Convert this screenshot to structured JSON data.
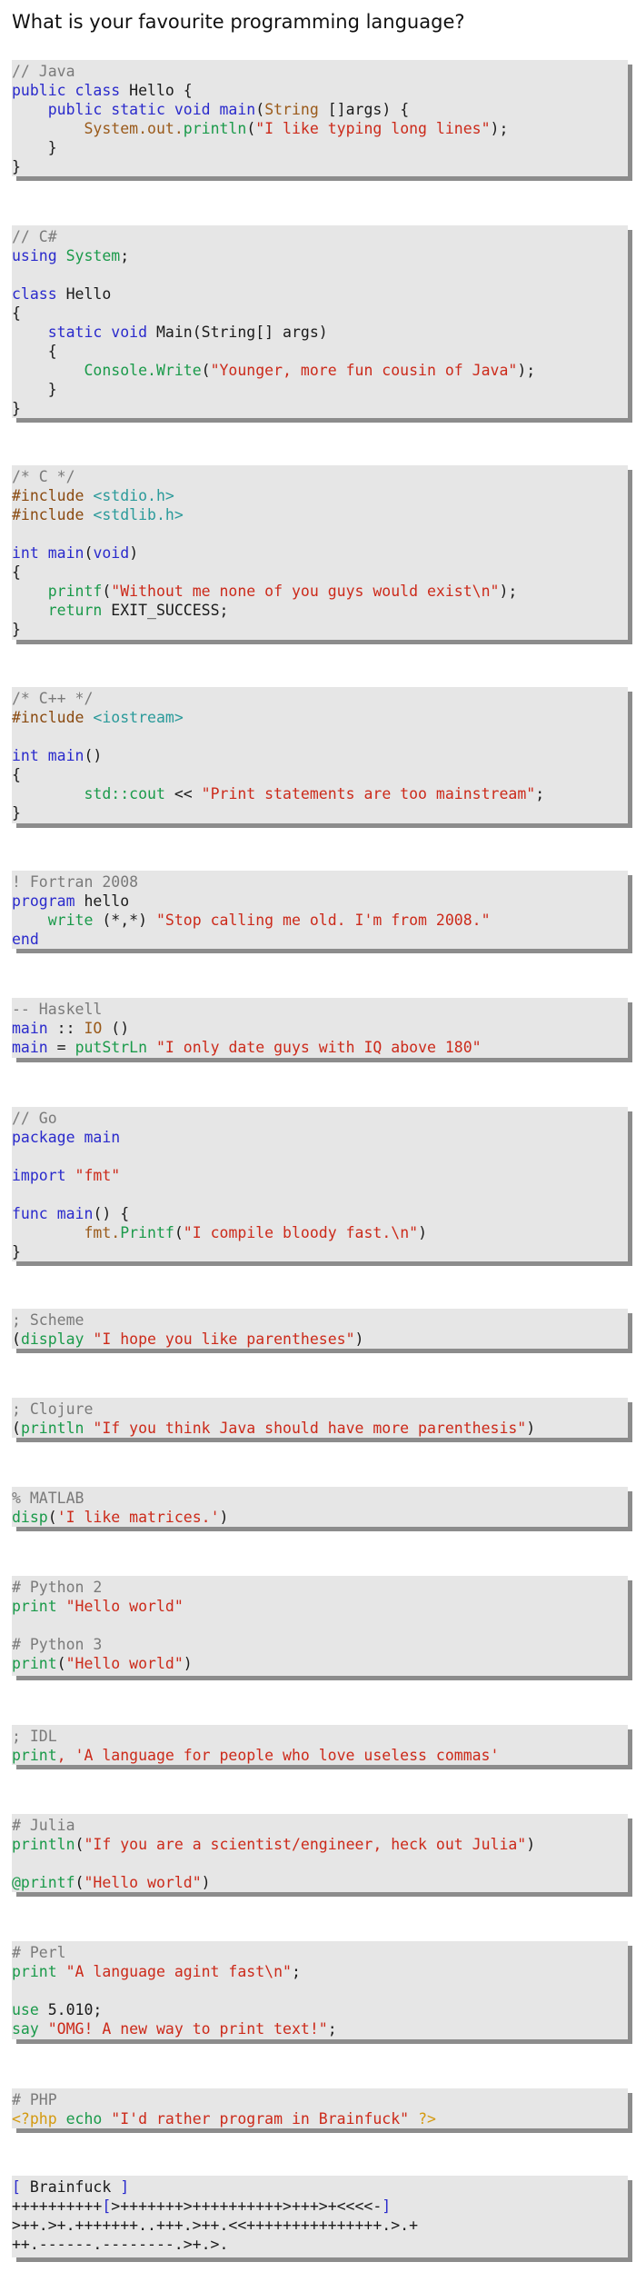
{
  "page": {
    "title": "What is your favourite programming language?"
  },
  "colors": {
    "comment": "#7a7a7a",
    "keyword": "#2a2acc",
    "string": "#cc2a1a",
    "function": "#1a9a4a",
    "type": "#9a5a1a",
    "preprocessor": "#8a4a10",
    "include_file": "#2a9a9a",
    "php_tag": "#d49a10",
    "block_background": "#e6e6e6",
    "block_shadow": "#8c8c8c"
  },
  "snippets": [
    {
      "language": "java",
      "lines": [
        [
          [
            "com",
            "// Java"
          ]
        ],
        [
          [
            "kw",
            "public class"
          ],
          [
            "pl",
            " Hello {"
          ]
        ],
        [
          [
            "pl",
            "    "
          ],
          [
            "kw",
            "public static void"
          ],
          [
            "pl",
            " "
          ],
          [
            "kw",
            "main"
          ],
          [
            "pl",
            "("
          ],
          [
            "typ",
            "String"
          ],
          [
            "pl",
            " []args) {"
          ]
        ],
        [
          [
            "pl",
            "        "
          ],
          [
            "typ",
            "System.out."
          ],
          [
            "fn",
            "println"
          ],
          [
            "pl",
            "("
          ],
          [
            "str",
            "\"I like typing long lines\""
          ],
          [
            "pl",
            ");"
          ]
        ],
        [
          [
            "pl",
            "    }"
          ]
        ],
        [
          [
            "pl",
            "}"
          ]
        ]
      ]
    },
    {
      "language": "csharp",
      "lines": [
        [
          [
            "com",
            "// C#"
          ]
        ],
        [
          [
            "kw",
            "using"
          ],
          [
            "pl",
            " "
          ],
          [
            "fn",
            "System"
          ],
          [
            "pl",
            ";"
          ]
        ],
        [
          [
            "pl",
            ""
          ]
        ],
        [
          [
            "kw",
            "class"
          ],
          [
            "pl",
            " Hello"
          ]
        ],
        [
          [
            "pl",
            "{"
          ]
        ],
        [
          [
            "pl",
            "    "
          ],
          [
            "kw",
            "static void"
          ],
          [
            "pl",
            " Main(String[] args)"
          ]
        ],
        [
          [
            "pl",
            "    {"
          ]
        ],
        [
          [
            "pl",
            "        "
          ],
          [
            "fn",
            "Console.Write"
          ],
          [
            "pl",
            "("
          ],
          [
            "str",
            "\"Younger, more fun cousin of Java\""
          ],
          [
            "pl",
            ");"
          ]
        ],
        [
          [
            "pl",
            "    }"
          ]
        ],
        [
          [
            "pl",
            "}"
          ]
        ]
      ]
    },
    {
      "language": "c",
      "lines": [
        [
          [
            "com",
            "/* C */"
          ]
        ],
        [
          [
            "pre",
            "#include"
          ],
          [
            "pl",
            " "
          ],
          [
            "inc",
            "<stdio.h>"
          ]
        ],
        [
          [
            "pre",
            "#include"
          ],
          [
            "pl",
            " "
          ],
          [
            "inc",
            "<stdlib.h>"
          ]
        ],
        [
          [
            "pl",
            ""
          ]
        ],
        [
          [
            "kw",
            "int"
          ],
          [
            "pl",
            " "
          ],
          [
            "kw",
            "main"
          ],
          [
            "pl",
            "("
          ],
          [
            "kw",
            "void"
          ],
          [
            "pl",
            ")"
          ]
        ],
        [
          [
            "pl",
            "{"
          ]
        ],
        [
          [
            "pl",
            "    "
          ],
          [
            "fn",
            "printf"
          ],
          [
            "pl",
            "("
          ],
          [
            "str",
            "\"Without me none of you guys would exist\\n\""
          ],
          [
            "pl",
            ");"
          ]
        ],
        [
          [
            "pl",
            "    "
          ],
          [
            "fn",
            "return"
          ],
          [
            "pl",
            " EXIT_SUCCESS;"
          ]
        ],
        [
          [
            "pl",
            "}"
          ]
        ]
      ]
    },
    {
      "language": "cpp",
      "lines": [
        [
          [
            "com",
            "/* C++ */"
          ]
        ],
        [
          [
            "pre",
            "#include"
          ],
          [
            "pl",
            " "
          ],
          [
            "inc",
            "<iostream>"
          ]
        ],
        [
          [
            "pl",
            ""
          ]
        ],
        [
          [
            "kw",
            "int"
          ],
          [
            "pl",
            " "
          ],
          [
            "kw",
            "main"
          ],
          [
            "pl",
            "()"
          ]
        ],
        [
          [
            "pl",
            "{"
          ]
        ],
        [
          [
            "pl",
            "        "
          ],
          [
            "fn",
            "std::cout"
          ],
          [
            "pl",
            " << "
          ],
          [
            "str",
            "\"Print statements are too mainstream\""
          ],
          [
            "pl",
            ";"
          ]
        ],
        [
          [
            "pl",
            "}"
          ]
        ]
      ]
    },
    {
      "language": "fortran",
      "lines": [
        [
          [
            "com",
            "! Fortran 2008"
          ]
        ],
        [
          [
            "kw",
            "program"
          ],
          [
            "pl",
            " hello"
          ]
        ],
        [
          [
            "pl",
            "    "
          ],
          [
            "fn",
            "write"
          ],
          [
            "pl",
            " (*,*) "
          ],
          [
            "str",
            "\"Stop calling me old. I'm from 2008.\""
          ]
        ],
        [
          [
            "kw",
            "end"
          ]
        ]
      ]
    },
    {
      "language": "haskell",
      "lines": [
        [
          [
            "com",
            "-- Haskell"
          ]
        ],
        [
          [
            "kw",
            "main"
          ],
          [
            "pl",
            " :: "
          ],
          [
            "typ",
            "IO"
          ],
          [
            "pl",
            " ()"
          ]
        ],
        [
          [
            "kw",
            "main"
          ],
          [
            "pl",
            " = "
          ],
          [
            "fn",
            "putStrLn"
          ],
          [
            "pl",
            " "
          ],
          [
            "str",
            "\"I only date guys with IQ above 180\""
          ]
        ]
      ]
    },
    {
      "language": "go",
      "lines": [
        [
          [
            "com",
            "// Go"
          ]
        ],
        [
          [
            "kw",
            "package main"
          ]
        ],
        [
          [
            "pl",
            ""
          ]
        ],
        [
          [
            "kw",
            "import"
          ],
          [
            "pl",
            " "
          ],
          [
            "str",
            "\"fmt\""
          ]
        ],
        [
          [
            "pl",
            ""
          ]
        ],
        [
          [
            "kw",
            "func"
          ],
          [
            "pl",
            " "
          ],
          [
            "kw",
            "main"
          ],
          [
            "pl",
            "() {"
          ]
        ],
        [
          [
            "pl",
            "        "
          ],
          [
            "typ",
            "fmt."
          ],
          [
            "fn",
            "Printf"
          ],
          [
            "pl",
            "("
          ],
          [
            "str",
            "\"I compile bloody fast.\\n\""
          ],
          [
            "pl",
            ")"
          ]
        ],
        [
          [
            "pl",
            "}"
          ]
        ]
      ]
    },
    {
      "language": "scheme",
      "lines": [
        [
          [
            "com",
            "; Scheme"
          ]
        ],
        [
          [
            "pl",
            "("
          ],
          [
            "fn",
            "display"
          ],
          [
            "pl",
            " "
          ],
          [
            "str",
            "\"I hope you like parentheses\""
          ],
          [
            "pl",
            ")"
          ]
        ]
      ]
    },
    {
      "language": "clojure",
      "lines": [
        [
          [
            "com",
            "; Clojure"
          ]
        ],
        [
          [
            "pl",
            "("
          ],
          [
            "fn",
            "println"
          ],
          [
            "pl",
            " "
          ],
          [
            "str",
            "\"If you think Java should have more parenthesis\""
          ],
          [
            "pl",
            ")"
          ]
        ]
      ]
    },
    {
      "language": "matlab",
      "lines": [
        [
          [
            "com",
            "% MATLAB"
          ]
        ],
        [
          [
            "fn",
            "disp"
          ],
          [
            "pl",
            "("
          ],
          [
            "str",
            "'I like matrices.'"
          ],
          [
            "pl",
            ")"
          ]
        ]
      ]
    },
    {
      "language": "python",
      "lines": [
        [
          [
            "com",
            "# Python 2"
          ]
        ],
        [
          [
            "fn",
            "print"
          ],
          [
            "pl",
            " "
          ],
          [
            "str",
            "\"Hello world\""
          ]
        ],
        [
          [
            "pl",
            ""
          ]
        ],
        [
          [
            "com",
            "# Python 3"
          ]
        ],
        [
          [
            "fn",
            "print"
          ],
          [
            "pl",
            "("
          ],
          [
            "str",
            "\"Hello world\""
          ],
          [
            "pl",
            ")"
          ]
        ]
      ]
    },
    {
      "language": "idl",
      "lines": [
        [
          [
            "com",
            "; IDL"
          ]
        ],
        [
          [
            "fn",
            "print"
          ],
          [
            "str",
            ", 'A language for people who love useless commas'"
          ]
        ]
      ]
    },
    {
      "language": "julia",
      "lines": [
        [
          [
            "com",
            "# Julia"
          ]
        ],
        [
          [
            "fn",
            "println"
          ],
          [
            "pl",
            "("
          ],
          [
            "str",
            "\"If you are a scientist/engineer, heck out Julia\""
          ],
          [
            "pl",
            ")"
          ]
        ],
        [
          [
            "pl",
            ""
          ]
        ],
        [
          [
            "fn",
            "@printf"
          ],
          [
            "pl",
            "("
          ],
          [
            "str",
            "\"Hello world\""
          ],
          [
            "pl",
            ")"
          ]
        ]
      ]
    },
    {
      "language": "perl",
      "lines": [
        [
          [
            "com",
            "# Perl"
          ]
        ],
        [
          [
            "fn",
            "print"
          ],
          [
            "pl",
            " "
          ],
          [
            "str",
            "\"A language agint fast\\n\""
          ],
          [
            "pl",
            ";"
          ]
        ],
        [
          [
            "pl",
            ""
          ]
        ],
        [
          [
            "fn",
            "use"
          ],
          [
            "pl",
            " 5.010;"
          ]
        ],
        [
          [
            "fn",
            "say"
          ],
          [
            "pl",
            " "
          ],
          [
            "str",
            "\"OMG! A new way to print text!\""
          ],
          [
            "pl",
            ";"
          ]
        ]
      ]
    },
    {
      "language": "php",
      "lines": [
        [
          [
            "com",
            "# PHP"
          ]
        ],
        [
          [
            "php",
            "<?php"
          ],
          [
            "pl",
            " "
          ],
          [
            "fn",
            "echo"
          ],
          [
            "pl",
            " "
          ],
          [
            "str",
            "\"I'd rather program in Brainfuck\""
          ],
          [
            "pl",
            " "
          ],
          [
            "php",
            "?>"
          ]
        ]
      ]
    },
    {
      "language": "brainfuck",
      "lines": [
        [
          [
            "bf",
            "["
          ],
          [
            "pl",
            " Brainfuck "
          ],
          [
            "bf",
            "]"
          ]
        ],
        [
          [
            "pl",
            "++++++++++"
          ],
          [
            "bf",
            "["
          ],
          [
            "pl",
            ">+++++++>++++++++++>+++>+<<<<-"
          ],
          [
            "bf",
            "]"
          ]
        ],
        [
          [
            "pl",
            ">++.>+.+++++++..+++.>++.<<+++++++++++++++.>.+"
          ]
        ],
        [
          [
            "pl",
            "++.------.--------.>+.>."
          ]
        ]
      ]
    }
  ]
}
